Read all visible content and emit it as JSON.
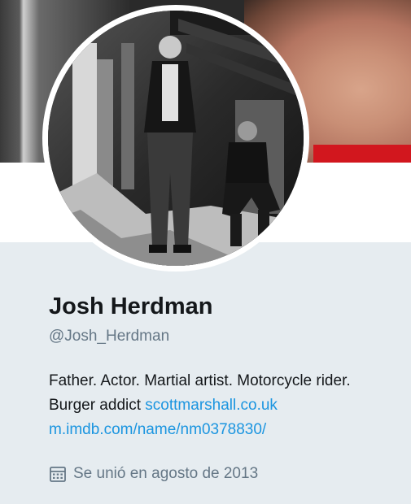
{
  "profile": {
    "display_name": "Josh Herdman",
    "handle": "@Josh_Herdman",
    "bio_text": "Father. Actor. Martial artist. Motorcycle rider. Burger addict",
    "links": [
      "scottmarshall.co.uk",
      "m.imdb.com/name/nm0378830/"
    ],
    "joined": "Se unió en agosto de 2013",
    "joined_icon": "calendar-icon"
  },
  "colors": {
    "background": "#e6ecf0",
    "name": "#14171a",
    "secondary": "#657786",
    "link": "#1b95e0"
  }
}
